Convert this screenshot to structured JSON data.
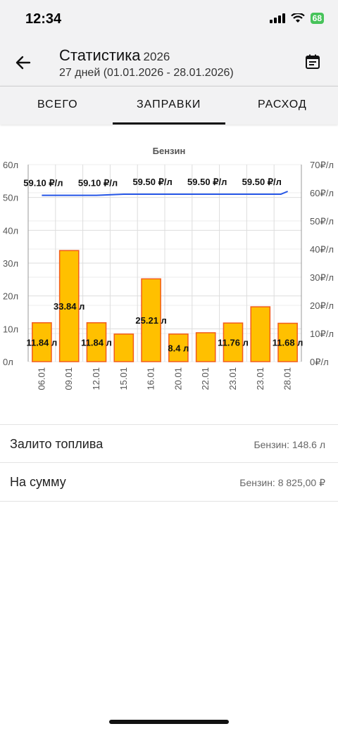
{
  "status_bar": {
    "time": "12:34",
    "battery": "68"
  },
  "header": {
    "title": "Статистика",
    "year": "2026",
    "subtitle": "27 дней (01.01.2026 - 28.01.2026)"
  },
  "tabs": [
    {
      "label": "ВСЕГО",
      "active": false
    },
    {
      "label": "ЗАПРАВКИ",
      "active": true
    },
    {
      "label": "РАСХОД",
      "active": false
    }
  ],
  "chart_data": {
    "type": "bar",
    "title": "Бензин",
    "categories": [
      "06.01",
      "09.01",
      "12.01",
      "15.01",
      "16.01",
      "20.01",
      "22.01",
      "23.01",
      "23.01",
      "28.01"
    ],
    "series": [
      {
        "axis": "left",
        "type": "bar",
        "values": [
          11.84,
          33.84,
          11.84,
          8.4,
          25.21,
          8.4,
          8.8,
          11.76,
          16.7,
          11.68
        ]
      },
      {
        "axis": "right",
        "type": "line",
        "values": [
          59.1,
          59.1,
          59.1,
          59.5,
          59.5,
          59.5,
          59.5,
          59.5,
          59.5,
          60.5
        ]
      }
    ],
    "bar_labels": [
      {
        "index": 0,
        "text": "11.84 л"
      },
      {
        "index": 1,
        "text": "33.84 л"
      },
      {
        "index": 2,
        "text": "11.84 л"
      },
      {
        "index": 4,
        "text": "25.21 л"
      },
      {
        "index": 5,
        "text": "8.4 л"
      },
      {
        "index": 7,
        "text": "11.76 л"
      },
      {
        "index": 9,
        "text": "11.68 л"
      }
    ],
    "line_labels": [
      {
        "index": 0,
        "text": "59.10 ₽/л"
      },
      {
        "index": 2,
        "text": "59.10 ₽/л"
      },
      {
        "index": 4,
        "text": "59.50 ₽/л"
      },
      {
        "index": 6,
        "text": "59.50 ₽/л"
      },
      {
        "index": 8,
        "text": "59.50 ₽/л"
      }
    ],
    "left_ticks": [
      "0л",
      "10л",
      "20л",
      "30л",
      "40л",
      "50л",
      "60л"
    ],
    "right_ticks": [
      "0₽/л",
      "10₽/л",
      "20₽/л",
      "30₽/л",
      "40₽/л",
      "50₽/л",
      "60₽/л",
      "70₽/л"
    ],
    "ylim_left": [
      0,
      60
    ],
    "ylim_right": [
      0,
      70
    ],
    "grid": true,
    "colors": {
      "bar_fill": "#ffc000",
      "bar_stroke": "#f25c1c",
      "line": "#2455e6",
      "grid": "#dddddd",
      "axis_text": "#555555"
    }
  },
  "summary": [
    {
      "label": "Залито топлива",
      "value": "Бензин: 148.6 л"
    },
    {
      "label": "На сумму",
      "value": "Бензин: 8 825,00 ₽"
    }
  ]
}
